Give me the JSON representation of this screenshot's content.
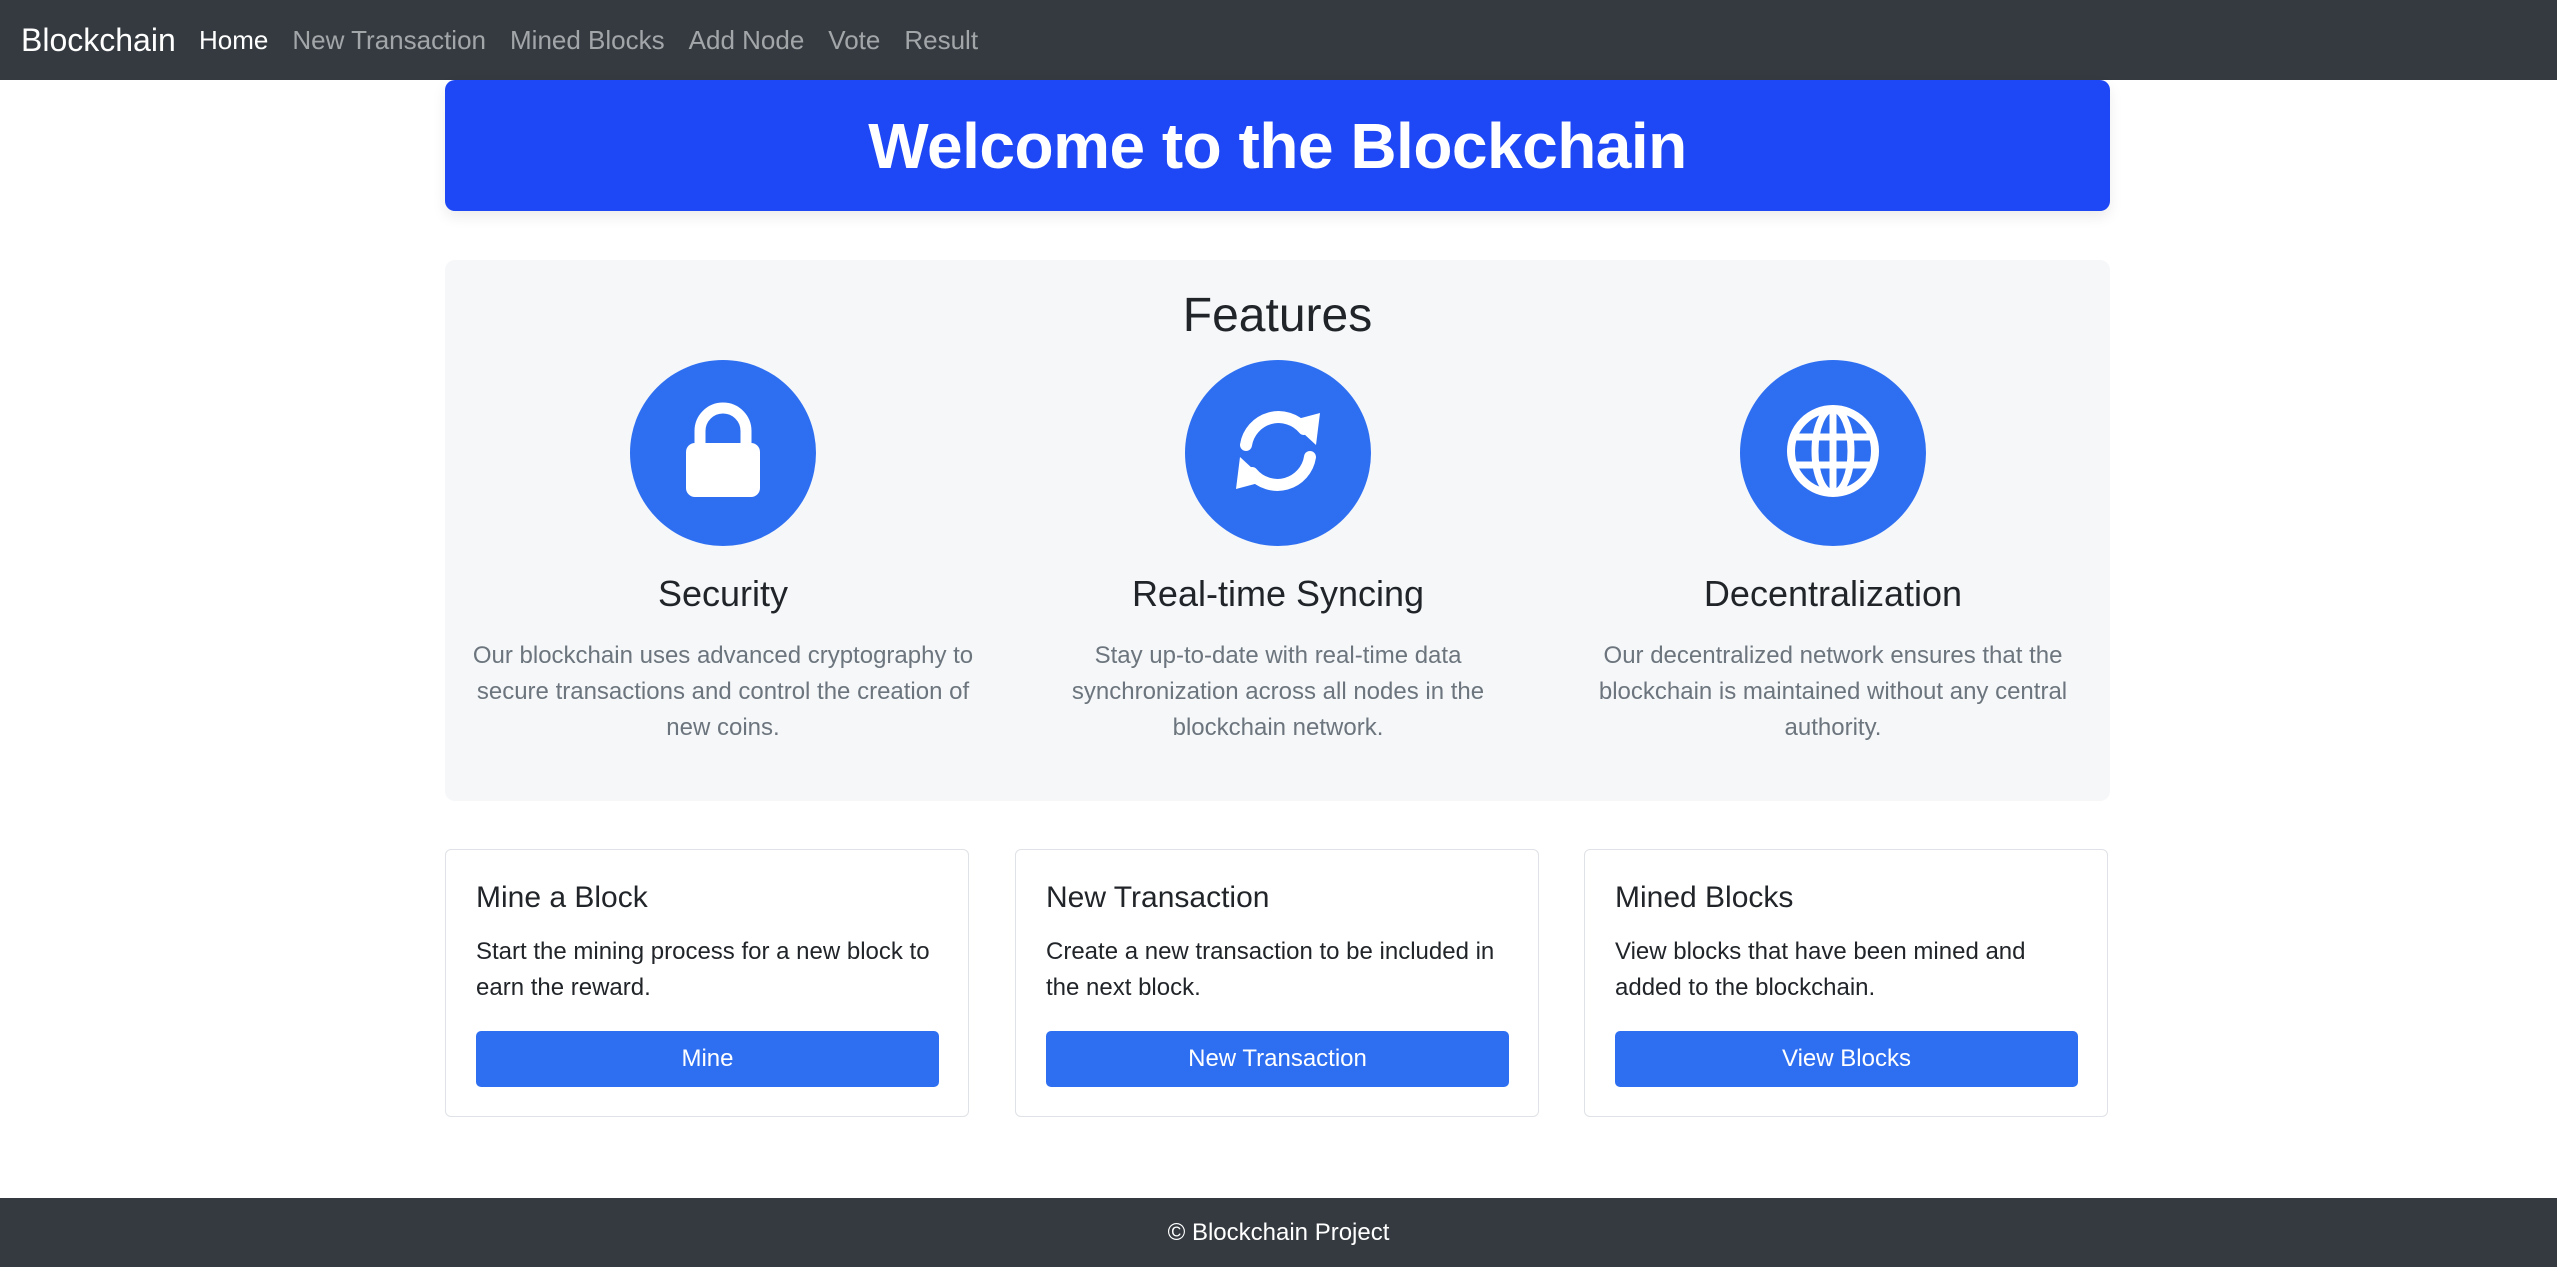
{
  "navbar": {
    "brand": "Blockchain",
    "links": [
      {
        "label": "Home",
        "active": true
      },
      {
        "label": "New Transaction",
        "active": false
      },
      {
        "label": "Mined Blocks",
        "active": false
      },
      {
        "label": "Add Node",
        "active": false
      },
      {
        "label": "Vote",
        "active": false
      },
      {
        "label": "Result",
        "active": false
      }
    ]
  },
  "hero": {
    "title": "Welcome to the Blockchain"
  },
  "features": {
    "heading": "Features",
    "items": [
      {
        "icon": "lock-icon",
        "title": "Security",
        "description": "Our blockchain uses advanced cryptography to secure transactions and control the creation of new coins."
      },
      {
        "icon": "sync-icon",
        "title": "Real-time Syncing",
        "description": "Stay up-to-date with real-time data synchronization across all nodes in the blockchain network."
      },
      {
        "icon": "globe-icon",
        "title": "Decentralization",
        "description": "Our decentralized network ensures that the blockchain is maintained without any central authority."
      }
    ]
  },
  "cards": [
    {
      "title": "Mine a Block",
      "text": "Start the mining process for a new block to earn the reward.",
      "button": "Mine"
    },
    {
      "title": "New Transaction",
      "text": "Create a new transaction to be included in the next block.",
      "button": "New Transaction"
    },
    {
      "title": "Mined Blocks",
      "text": "View blocks that have been mined and added to the blockchain.",
      "button": "View Blocks"
    }
  ],
  "footer": {
    "text": "© Blockchain Project"
  },
  "colors": {
    "navbar_bg": "#343a40",
    "hero_bg": "#1e48f5",
    "accent": "#2e6ff2",
    "features_bg": "#f5f7f9"
  }
}
